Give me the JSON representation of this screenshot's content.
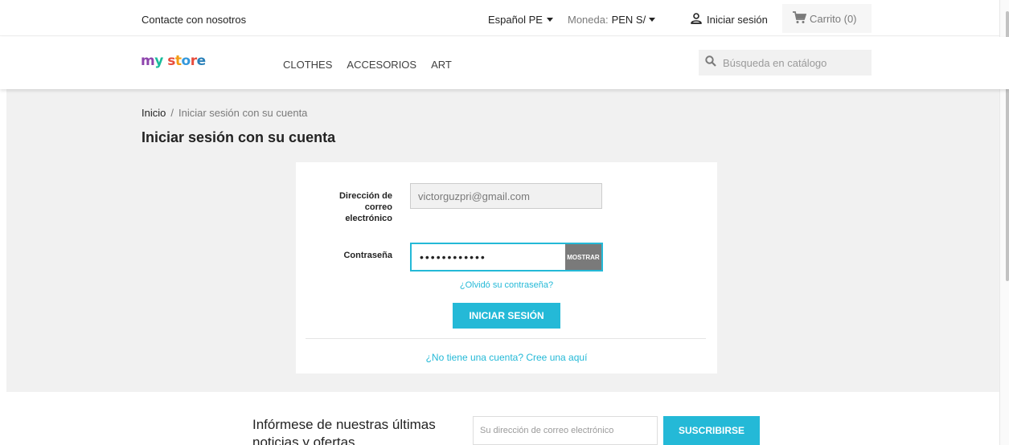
{
  "topbar": {
    "contact_label": "Contacte con nosotros",
    "language": "Español PE",
    "currency_label": "Moneda:",
    "currency_value": "PEN S/",
    "signin_label": "Iniciar sesión",
    "cart_label": "Carrito (0)"
  },
  "header": {
    "logo": [
      "m",
      "y",
      "s",
      "t",
      "o",
      "r",
      "e"
    ],
    "nav": [
      "CLOTHES",
      "ACCESORIOS",
      "ART"
    ],
    "search_placeholder": "Búsqueda en catálogo"
  },
  "breadcrumb": {
    "home": "Inicio",
    "separator": "/",
    "current": "Iniciar sesión con su cuenta"
  },
  "page_title": "Iniciar sesión con su cuenta",
  "login_form": {
    "email_label": "Dirección de correo electrónico",
    "email_value": "victorguzpri@gmail.com",
    "password_label": "Contraseña",
    "password_value": "passwordabcd",
    "show_button": "MOSTRAR",
    "forgot_link": "¿Olvidó su contraseña?",
    "submit_button": "INICIAR SESIÓN",
    "create_account_link": "¿No tiene una cuenta? Cree una aquí"
  },
  "newsletter": {
    "title": "Infórmese de nuestras últimas noticias y ofertas",
    "input_placeholder": "Su dirección de correo electrónico",
    "button": "SUSCRIBIRSE"
  },
  "colors": {
    "accent": "#24b9d7",
    "background_gray": "#f1f1f1"
  }
}
